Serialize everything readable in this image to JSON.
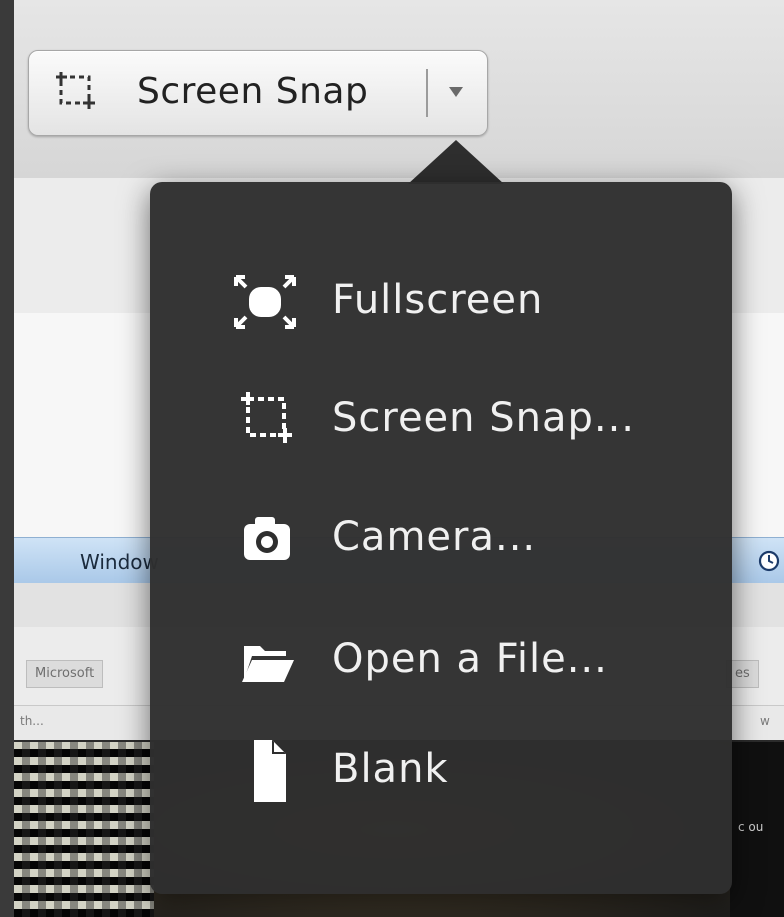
{
  "toolbar": {
    "snap_button_label": "Screen Snap",
    "snap_icon": "screen-snap-icon",
    "dropdown_icon": "chevron-down-icon"
  },
  "menu": {
    "items": [
      {
        "label": "Fullscreen",
        "icon": "fullscreen-icon"
      },
      {
        "label": "Screen Snap...",
        "icon": "screen-snap-icon"
      },
      {
        "label": "Camera...",
        "icon": "camera-icon"
      },
      {
        "label": "Open a File...",
        "icon": "folder-icon"
      },
      {
        "label": "Blank",
        "icon": "blank-page-icon"
      }
    ]
  },
  "background": {
    "taskbar_label": "Window",
    "tab_1": "Microsoft",
    "tab_2": "es",
    "sub_text_1": "th...",
    "sub_text_2": "w",
    "right_text": "c ou",
    "clock_icon": "clock-icon"
  }
}
